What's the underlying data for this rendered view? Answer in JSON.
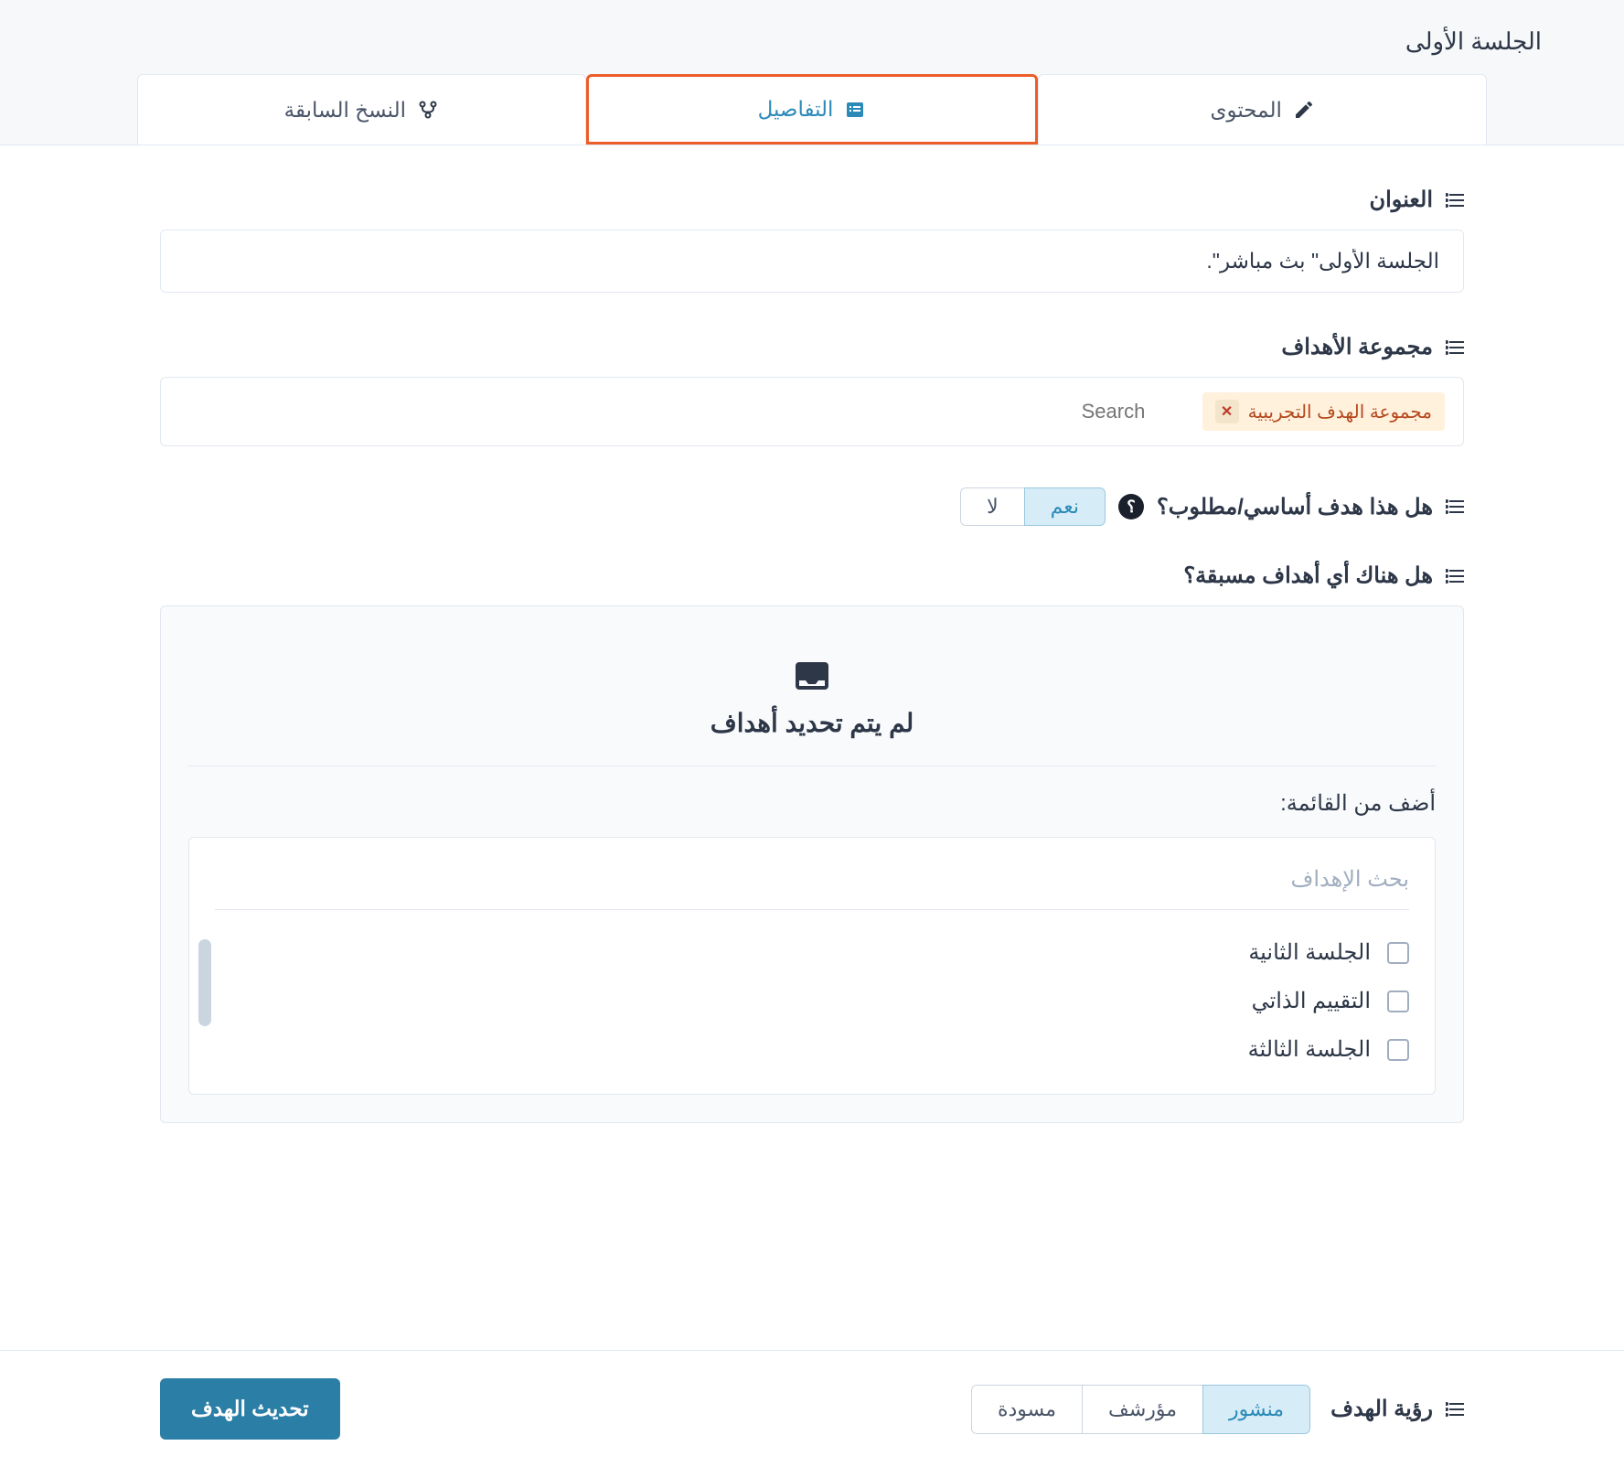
{
  "header": {
    "title": "الجلسة الأولى"
  },
  "tabs": {
    "content": "المحتوى",
    "details": "التفاصيل",
    "versions": "النسخ السابقة"
  },
  "fields": {
    "title_label": "العنوان",
    "title_value": "الجلسة الأولى\" بث مباشر\".",
    "group_label": "مجموعة الأهداف",
    "group_chip": "مجموعة الهدف التجريبية",
    "group_search_placeholder": "Search",
    "core_label": "هل هذا هدف أساسي/مطلوب؟",
    "core_yes": "نعم",
    "core_no": "لا",
    "prereq_label": "هل هناك أي أهداف مسبقة؟",
    "empty_state": "لم يتم تحديد أهداف",
    "add_from_list": "أضف من القائمة:",
    "goal_search_placeholder": "بحث الإهداف",
    "goals": [
      "الجلسة الثانية",
      "التقييم الذاتي",
      "الجلسة الثالثة"
    ]
  },
  "footer": {
    "visibility_label": "رؤية الهدف",
    "published": "منشور",
    "archived": "مؤرشف",
    "draft": "مسودة",
    "update": "تحديث الهدف"
  }
}
